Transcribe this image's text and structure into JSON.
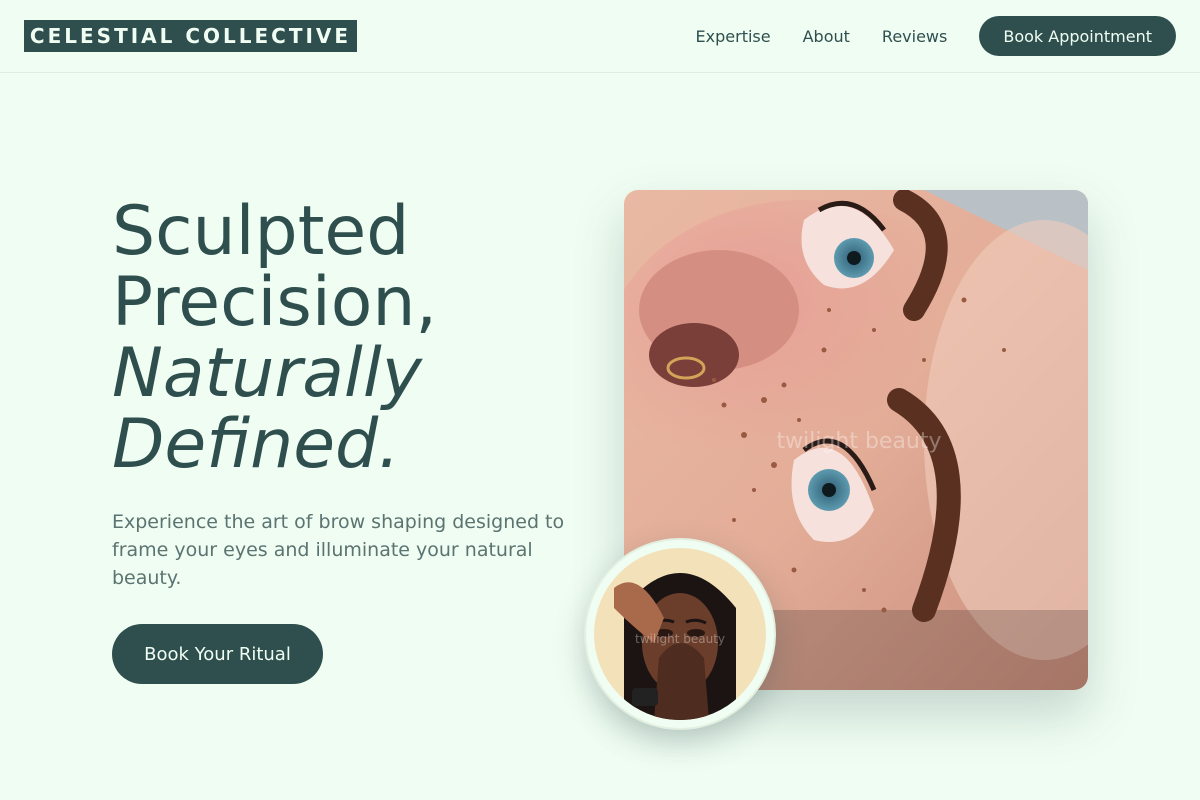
{
  "brand": {
    "name": "CELESTIAL COLLECTIVE"
  },
  "nav": {
    "links": [
      "Expertise",
      "About",
      "Reviews"
    ],
    "cta": "Book Appointment"
  },
  "hero": {
    "title_line1": "Sculpted",
    "title_line2": "Precision,",
    "title_line3": "Naturally",
    "title_line4": "Defined.",
    "subtitle": "Experience the art of brow shaping designed to frame your eyes and illuminate your natural beauty.",
    "cta": "Book Your Ritual"
  },
  "images": {
    "main_watermark": "twilight beauty",
    "inset_watermark": "twilight beauty"
  },
  "colors": {
    "background": "#f0fdf2",
    "primary": "#2f4f4f",
    "text_muted": "#5b7371"
  }
}
